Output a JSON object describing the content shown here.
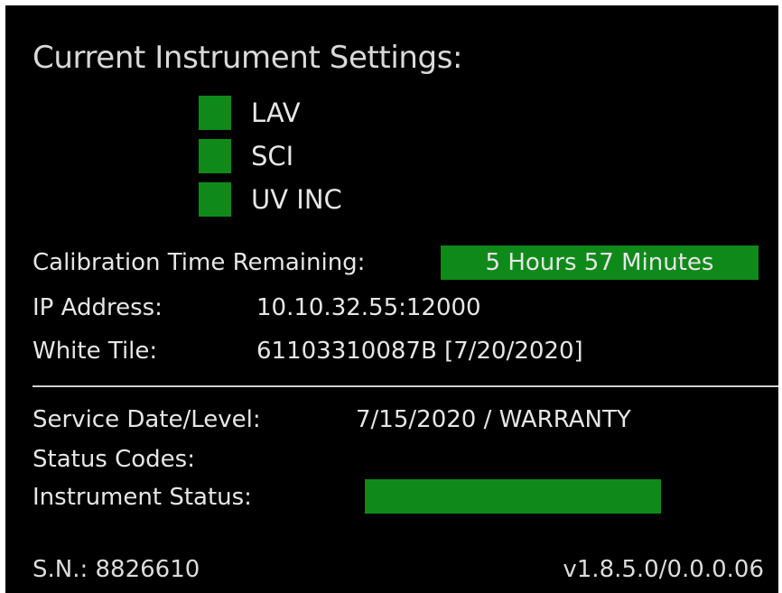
{
  "title": "Current Instrument Settings:",
  "settings": [
    {
      "label": "LAV",
      "indicator_color": "#0f8a1a"
    },
    {
      "label": "SCI",
      "indicator_color": "#0f8a1a"
    },
    {
      "label": "UV INC",
      "indicator_color": "#0f8a1a"
    }
  ],
  "calibration": {
    "label": "Calibration Time Remaining:",
    "value": "5 Hours 57 Minutes",
    "badge_color": "#0f8a1a"
  },
  "ip": {
    "label": "IP Address:",
    "value": "10.10.32.55:12000"
  },
  "white_tile": {
    "label": "White Tile:",
    "value": "61103310087B [7/20/2020]"
  },
  "service": {
    "label": "Service Date/Level:",
    "value": "7/15/2020 / WARRANTY"
  },
  "status_codes": {
    "label": "Status Codes:",
    "value": ""
  },
  "instrument_status": {
    "label": "Instrument Status:",
    "status_color": "#0f8a1a"
  },
  "footer": {
    "serial": "S.N.: 8826610",
    "version": "v1.8.5.0/0.0.0.06"
  }
}
